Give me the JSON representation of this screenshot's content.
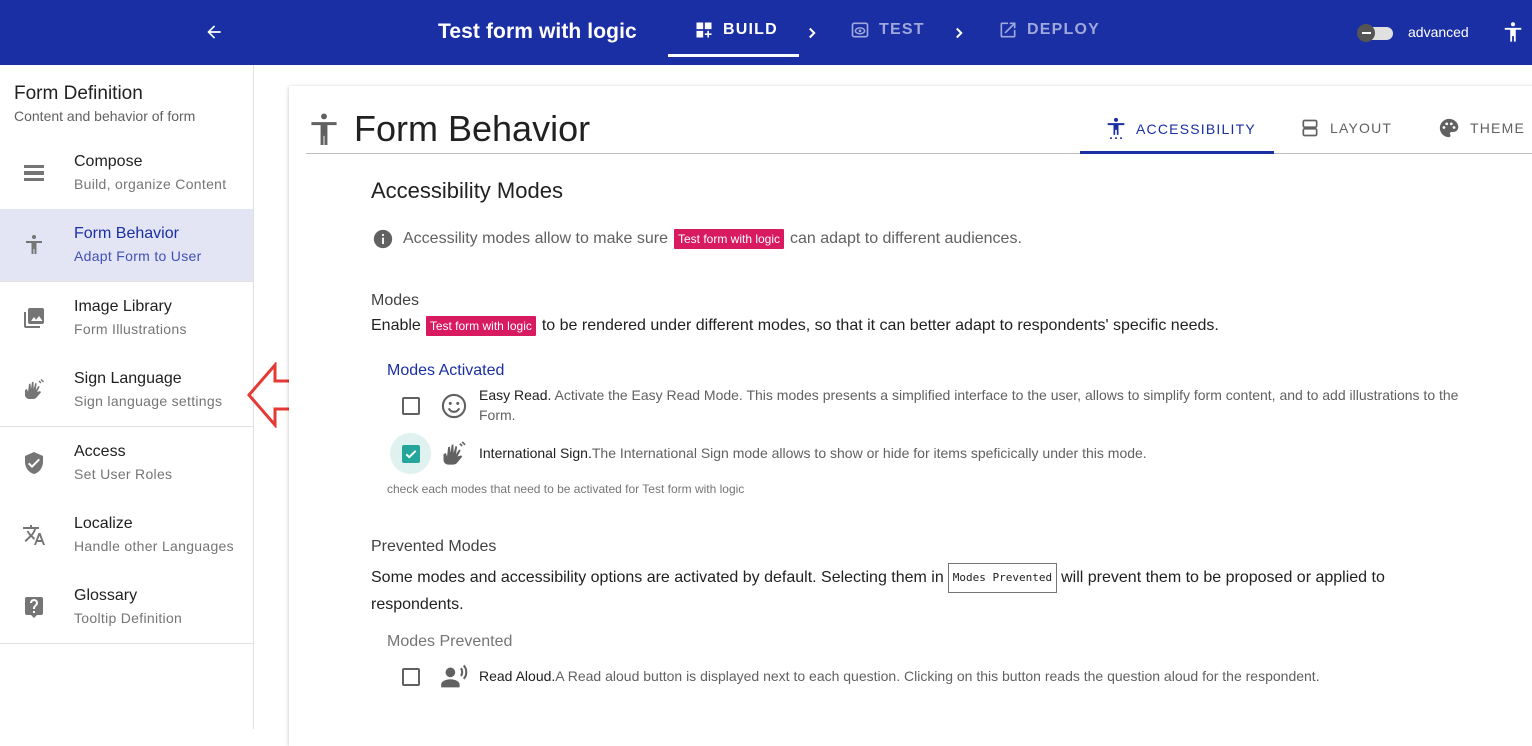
{
  "topbar": {
    "title": "Test form with logic",
    "steps": {
      "build": "BUILD",
      "test": "TEST",
      "deploy": "DEPLOY"
    },
    "advanced_label": "advanced"
  },
  "sidebar": {
    "title": "Form Definition",
    "subtitle": "Content and behavior of form",
    "items": [
      {
        "label": "Compose",
        "sub": "Build, organize Content",
        "icon": "compose-icon"
      },
      {
        "label": "Form Behavior",
        "sub": "Adapt Form to User",
        "icon": "accessibility-icon",
        "active": true
      },
      {
        "label": "Image Library",
        "sub": "Form Illustrations",
        "icon": "image-icon"
      },
      {
        "label": "Sign Language",
        "sub": "Sign language settings",
        "icon": "sign-language-icon"
      },
      {
        "label": "Access",
        "sub": "Set User Roles",
        "icon": "shield-icon"
      },
      {
        "label": "Localize",
        "sub": "Handle other Languages",
        "icon": "translate-icon"
      },
      {
        "label": "Glossary",
        "sub": "Tooltip Definition",
        "icon": "help-icon"
      }
    ]
  },
  "main": {
    "title": "Form Behavior",
    "tabs": {
      "accessibility": "ACCESSIBILITY",
      "layout": "LAYOUT",
      "theme": "THEME"
    },
    "section_title": "Accessibility Modes",
    "info": {
      "before": "Accessility modes allow to make sure",
      "chip": "Test form with logic",
      "after": "can adapt to different audiences."
    },
    "modes": {
      "heading": "Modes",
      "before": "Enable",
      "chip": "Test form with logic",
      "after": "to be rendered under different modes, so that it can better adapt to respondents' specific needs.",
      "activated_label": "Modes Activated",
      "easy_read": {
        "name": "Easy Read.",
        "desc": " Activate the Easy Read Mode. This modes presents a simplified interface to the user, allows to simplify form content, and to add illustrations to the Form.",
        "checked": false
      },
      "intl_sign": {
        "name": "International Sign.",
        "desc": "The International Sign mode allows to show or hide for items speficically under this mode.",
        "checked": true
      },
      "helper": "check each modes that need to be activated for Test form with logic"
    },
    "prevented": {
      "heading": "Prevented Modes",
      "before": "Some modes and accessibility options are activated by default. Selecting them in",
      "chip": "Modes Prevented",
      "after": "will prevent them to be proposed or applied to respondents.",
      "label": "Modes Prevented",
      "read_aloud": {
        "name": "Read Aloud.",
        "desc": "A Read aloud button is displayed next to each question. Clicking on this button reads the question aloud for the respondent.",
        "checked": false
      }
    }
  }
}
